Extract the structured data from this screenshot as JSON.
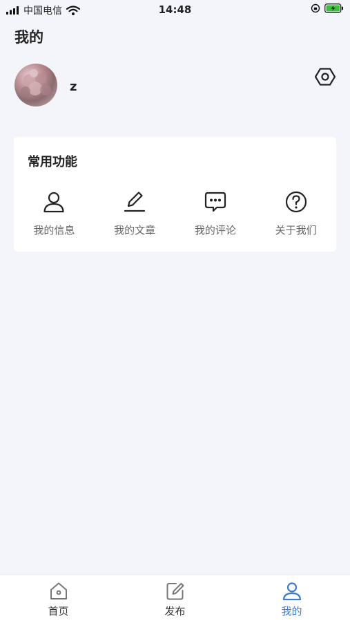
{
  "status_bar": {
    "carrier": "中国电信",
    "time": "14:48"
  },
  "page": {
    "title": "我的"
  },
  "profile": {
    "username": "z"
  },
  "functions_card": {
    "title": "常用功能",
    "items": [
      {
        "label": "我的信息",
        "icon": "user-icon"
      },
      {
        "label": "我的文章",
        "icon": "pen-icon"
      },
      {
        "label": "我的评论",
        "icon": "comment-icon"
      },
      {
        "label": "关于我们",
        "icon": "question-icon"
      }
    ]
  },
  "tab_bar": {
    "tabs": [
      {
        "label": "首页",
        "icon": "home-icon",
        "active": false
      },
      {
        "label": "发布",
        "icon": "edit-icon",
        "active": false
      },
      {
        "label": "我的",
        "icon": "user-icon",
        "active": true
      }
    ]
  },
  "colors": {
    "background": "#f3f5fa",
    "accent": "#3a7bd5",
    "battery": "#3cc13b"
  }
}
